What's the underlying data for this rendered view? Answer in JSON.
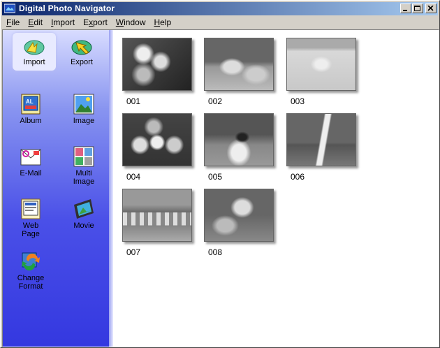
{
  "window": {
    "title": "Digital Photo Navigator"
  },
  "menu": [
    "File",
    "Edit",
    "Import",
    "Export",
    "Window",
    "Help"
  ],
  "menu_underline": [
    "F",
    "E",
    "I",
    "x",
    "W",
    "H"
  ],
  "sidebar": {
    "top": [
      {
        "label": "Import",
        "icon": "import-icon"
      },
      {
        "label": "Export",
        "icon": "export-icon"
      }
    ],
    "tools": [
      {
        "label": "Album",
        "icon": "album-icon"
      },
      {
        "label": "Image",
        "icon": "image-icon"
      },
      {
        "label": "E-Mail",
        "icon": "email-icon"
      },
      {
        "label": "Multi\nImage",
        "icon": "multi-image-icon"
      },
      {
        "label": "Web\nPage",
        "icon": "web-page-icon"
      },
      {
        "label": "Movie",
        "icon": "movie-icon"
      },
      {
        "label": "Change\nFormat",
        "icon": "change-format-icon"
      }
    ]
  },
  "thumbnails": [
    "001",
    "002",
    "003",
    "004",
    "005",
    "006",
    "007",
    "008"
  ]
}
